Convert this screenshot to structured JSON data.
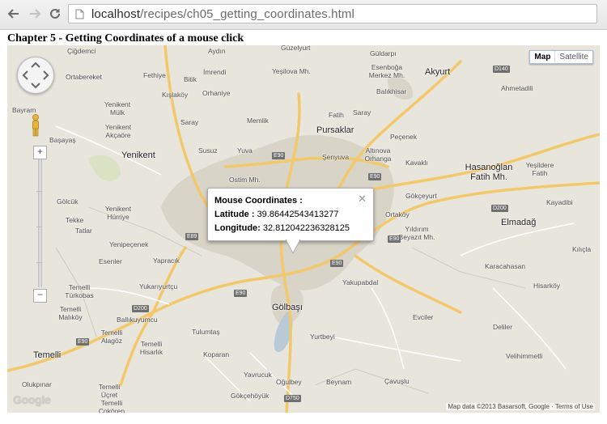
{
  "browser": {
    "url_host": "localhost",
    "url_path": "/recipes/ch05_getting_coordinates.html"
  },
  "page": {
    "chapter_title": "Chapter 5 - Getting Coordinates of a mouse click"
  },
  "map": {
    "map_type_buttons": {
      "map": "Map",
      "satellite": "Satellite"
    },
    "labels": [
      "Çiğdemci",
      "Aydın",
      "Güzelyurt",
      "Güldarpı",
      "Ortabereket",
      "Fethiye",
      "İmrendi",
      "Yeşilova Mh.",
      "Esenboğa Merkez Mh.",
      "Akyurt",
      "Bitik",
      "Kışlaköy",
      "Orhaniye",
      "Balıkhisar",
      "Ahmetadili",
      "Bayram",
      "Yenikent Mülk",
      "Memlik",
      "Fatih",
      "Saray",
      "Yenikent Akçaöre",
      "Saray",
      "Pursaklar",
      "Peçenek",
      "Başayaş",
      "Yenikent",
      "Susuz",
      "Yuva",
      "Şenyuva",
      "Altınova Orhanga",
      "Kavaklı",
      "Hasanoğlan Fatih Mh.",
      "Yeşildere Fatih",
      "Ostim Mh.",
      "Gölcük",
      "Yenikent Hürriye",
      "Gökçeyurt",
      "Ortaköy",
      "Kayadibi",
      "Tekke",
      "Yıldırım Beyazıt Mh.",
      "Elmadağ",
      "Tatlar",
      "Yenipeçenek",
      "Kılıçla",
      "Esenler",
      "Yapracık",
      "Karacahasan",
      "Temelli Türkobas",
      "Yukarıyurtçu",
      "Yakupabdal",
      "Hisarköy",
      "Temelli Malıköy",
      "Ballıkuyumcu",
      "Gölbaşı",
      "Evciler",
      "Deliler",
      "Tulumtaş",
      "Temelli Alagöz",
      "Temelli Hisarlık",
      "Yurtbeyi",
      "Temelli",
      "Koparan",
      "Velihimmetli",
      "Olukpınar",
      "Temelli Üçret",
      "Yavrucuk",
      "Oğulbey",
      "Beynam",
      "Çavuşlu",
      "Temelli Çokören",
      "Gökçehöyük"
    ],
    "road_shields": [
      "D140",
      "E90",
      "E89",
      "E90",
      "D200",
      "E90",
      "E90",
      "E90",
      "D200",
      "D750",
      "E90"
    ],
    "info_window": {
      "title": "Mouse Coordinates :",
      "latitude_label": "Latitude :",
      "latitude_value": "39.86442543413277",
      "longitude_label": "Longitude:",
      "longitude_value": "32.812042236328125"
    },
    "logo_text": "Google",
    "attribution": "Map data ©2013 Basarsoft, Google · Terms of Use"
  }
}
